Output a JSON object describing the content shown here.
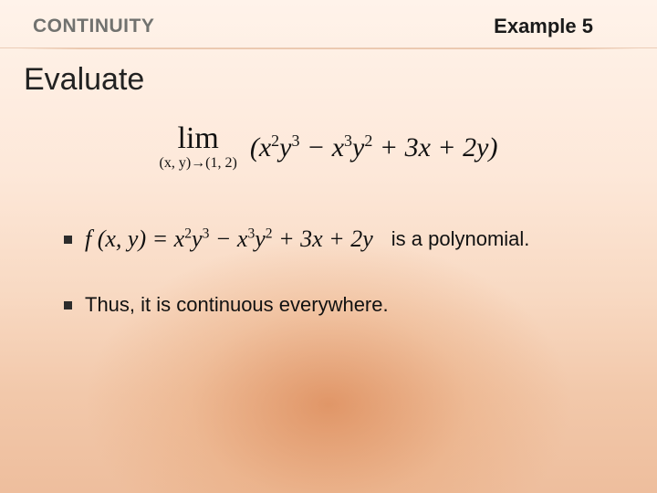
{
  "header": {
    "topic": "CONTINUITY",
    "example_label": "Example 5"
  },
  "title": "Evaluate",
  "limit": {
    "operator": "lim",
    "approach_text": "(x, y)→(1, 2)",
    "expression_html": "(x<sup>2</sup>y<sup>3</sup> − x<sup>3</sup>y<sup>2</sup> + 3x + 2y)"
  },
  "bullet1": {
    "func_lhs_html": "f (x, y) = x<sup>2</sup>y<sup>3</sup> − x<sup>3</sup>y<sup>2</sup> + 3x + 2y",
    "tail": "is a polynomial."
  },
  "bullet2": {
    "text": "Thus, it is continuous everywhere."
  }
}
